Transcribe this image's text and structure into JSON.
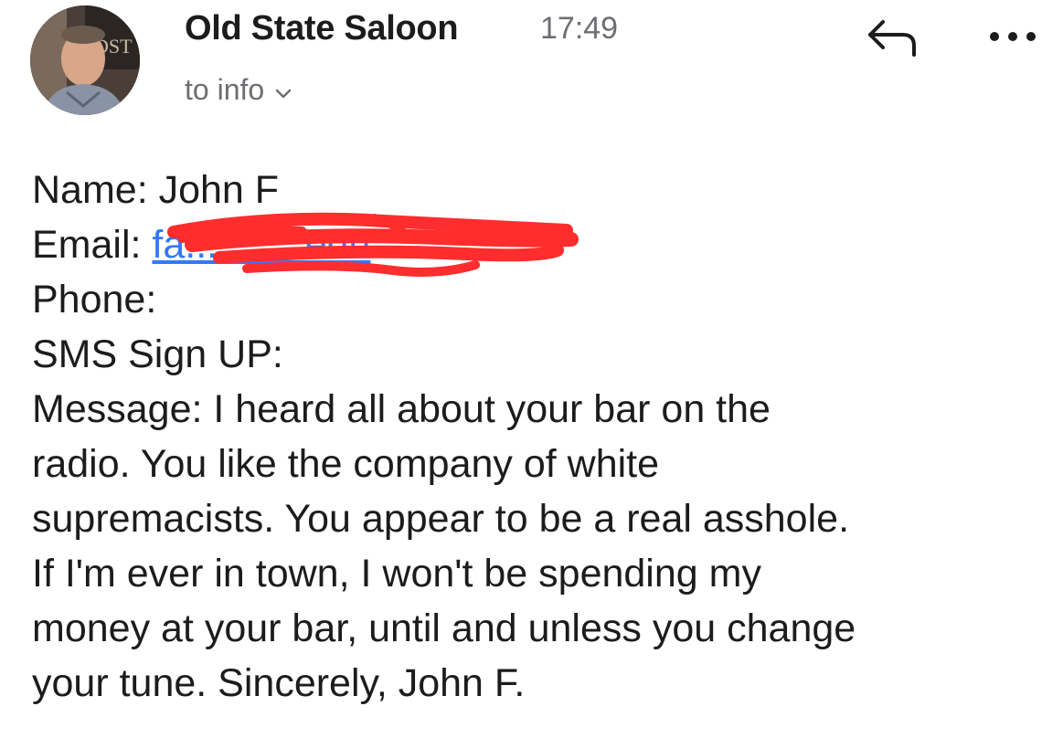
{
  "header": {
    "sender_name": "Old State Saloon",
    "time": "17:49",
    "recipient": "to info",
    "avatar_sign_text": "DST"
  },
  "icons": {
    "avatar": "sender-photo",
    "reply": "reply-arrow-icon",
    "more": "ellipsis-icon",
    "chevron": "chevron-down-icon"
  },
  "email_body": {
    "name_line": "Name: John F",
    "email_label": "Email:",
    "email_value": "fa...........edu",
    "phone_line": "Phone:",
    "sms_line": "SMS Sign UP:",
    "message_lines": [
      "Message: I heard all about your bar on the",
      "radio. You like the company of white",
      "supremacists. You appear to be a real asshole.",
      "If I'm ever in town, I won't be spending my",
      "money at your bar, until and unless you change",
      "your tune. Sincerely, John F."
    ]
  },
  "colors": {
    "link": "#3478f6",
    "redaction": "#ff2d2d",
    "secondary_text": "#6e6e73",
    "primary_text": "#1c1c1e"
  }
}
